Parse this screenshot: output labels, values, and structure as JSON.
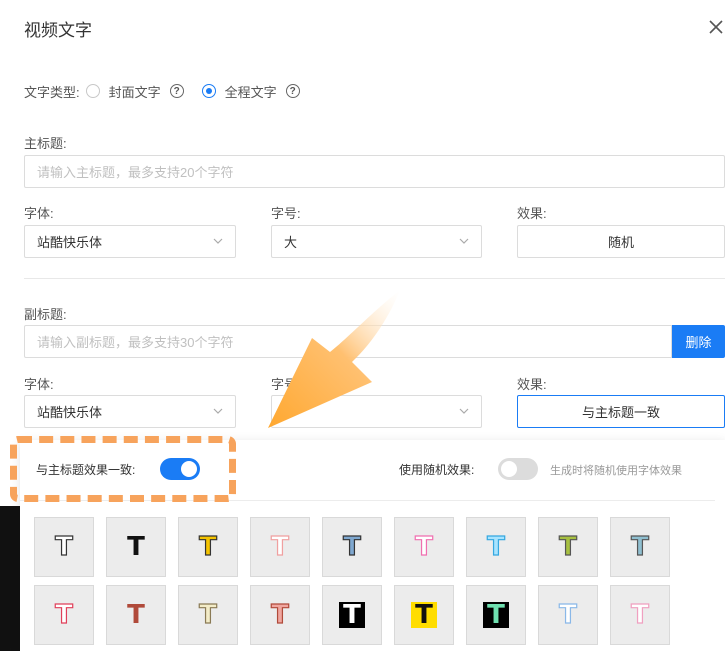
{
  "modal": {
    "title": "视频文字"
  },
  "text_type": {
    "label": "文字类型:",
    "options": [
      {
        "label": "封面文字",
        "selected": false
      },
      {
        "label": "全程文字",
        "selected": true
      }
    ]
  },
  "main_title": {
    "label": "主标题:",
    "placeholder": "请输入主标题，最多支持20个字符",
    "font_label": "字体:",
    "font_value": "站酷快乐体",
    "size_label": "字号:",
    "size_value": "大",
    "effect_label": "效果:",
    "effect_value": "随机"
  },
  "sub_title": {
    "label": "副标题:",
    "placeholder": "请输入副标题，最多支持30个字符",
    "delete_label": "删除",
    "font_label": "字体:",
    "font_value": "站酷快乐体",
    "size_label": "字号:",
    "size_value": "",
    "effect_label": "效果:",
    "effect_value": "与主标题一致"
  },
  "effect_popup": {
    "same_as_main_label": "与主标题效果一致:",
    "same_as_main_on": true,
    "random_label": "使用随机效果:",
    "random_on": false,
    "random_hint": "生成时将随机使用字体效果",
    "tile_glyph": "T",
    "tiles": [
      {
        "name": "outline-white",
        "fill": "#ffffff",
        "stroke": "#333333",
        "bg": ""
      },
      {
        "name": "solid-black",
        "fill": "#111111",
        "stroke": "",
        "bg": ""
      },
      {
        "name": "yellow-outline",
        "fill": "#f5c400",
        "stroke": "#333333",
        "bg": ""
      },
      {
        "name": "pink-light",
        "fill": "#ffffff",
        "stroke": "#f0a0a0",
        "bg": ""
      },
      {
        "name": "blue-gray",
        "fill": "#7fa8d0",
        "stroke": "#333333",
        "bg": ""
      },
      {
        "name": "pink-outline",
        "fill": "#ffffff",
        "stroke": "#f06fb0",
        "bg": ""
      },
      {
        "name": "cyan-outline",
        "fill": "#a8e4ff",
        "stroke": "#35a8e0",
        "bg": ""
      },
      {
        "name": "olive",
        "fill": "#a7c040",
        "stroke": "#555555",
        "bg": ""
      },
      {
        "name": "teal-gray",
        "fill": "#8fbfd0",
        "stroke": "#555555",
        "bg": ""
      },
      {
        "name": "red-outline",
        "fill": "#ffffff",
        "stroke": "#e0405a",
        "bg": ""
      },
      {
        "name": "brown-red",
        "fill": "#b04a3a",
        "stroke": "",
        "bg": ""
      },
      {
        "name": "cream",
        "fill": "#f3ecc8",
        "stroke": "#8a7a55",
        "bg": ""
      },
      {
        "name": "salmon",
        "fill": "#f0a7a0",
        "stroke": "#b04a3a",
        "bg": ""
      },
      {
        "name": "white-on-black",
        "fill": "#ffffff",
        "stroke": "",
        "bg": "#000000"
      },
      {
        "name": "black-on-yellow",
        "fill": "#111111",
        "stroke": "",
        "bg": "#ffdd00"
      },
      {
        "name": "mint-on-black",
        "fill": "#6fe0b0",
        "stroke": "",
        "bg": "#000000"
      },
      {
        "name": "white-blue-shadow",
        "fill": "#ffffff",
        "stroke": "#8ab8e8",
        "bg": ""
      },
      {
        "name": "white-pink-shadow",
        "fill": "#ffffff",
        "stroke": "#f0a0c0",
        "bg": ""
      }
    ]
  },
  "colors": {
    "accent": "#1a7cf5",
    "highlight": "#f7a35c",
    "arrow": "#ffb347"
  }
}
